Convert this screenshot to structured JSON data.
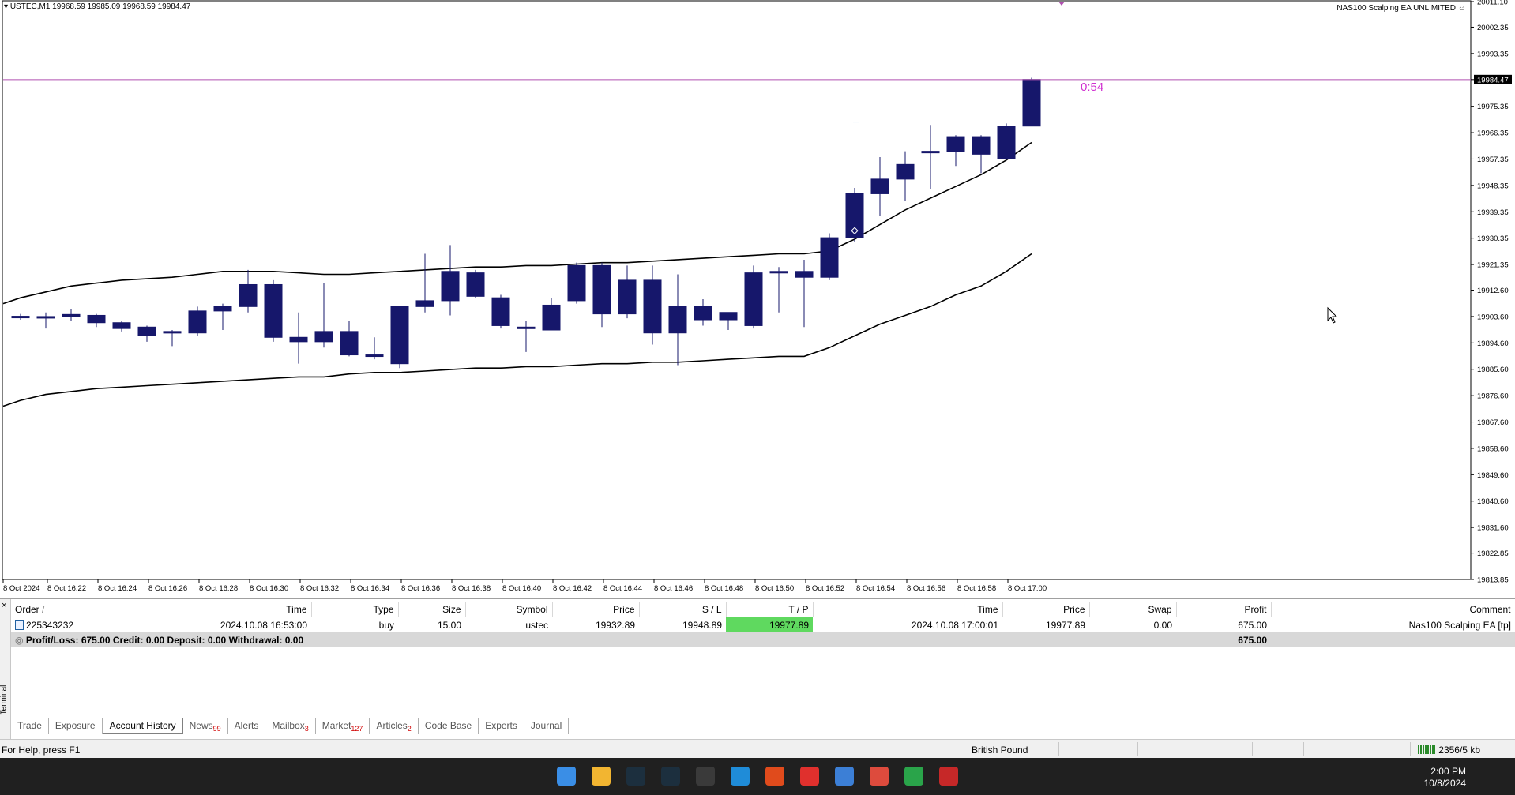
{
  "chart": {
    "info_text": "USTEC,M1  19968.59 19985.09 19968.59 19984.47",
    "ea_label": "NAS100 Scalping EA UNLIMITED",
    "countdown": "0:54",
    "current_price_label": "19984.47",
    "colors": {
      "candle": "#16176b",
      "price_line": "#b050b0",
      "countdown": "#d030d0",
      "band": "#000000"
    }
  },
  "chart_data": {
    "type": "candlestick",
    "symbol": "USTEC",
    "timeframe": "M1",
    "price_axis": {
      "range": [
        19813.85,
        20011.1
      ],
      "ticks": [
        "20011.10",
        "20002.35",
        "19993.35",
        "19984.47",
        "19975.35",
        "19966.35",
        "19957.35",
        "19948.35",
        "19939.35",
        "19930.35",
        "19921.35",
        "19912.60",
        "19903.60",
        "19894.60",
        "19885.60",
        "19876.60",
        "19867.60",
        "19858.60",
        "19849.60",
        "19840.60",
        "19831.60",
        "19822.85",
        "19813.85"
      ]
    },
    "time_axis_labels": [
      "8 Oct 2024",
      "8 Oct 16:22",
      "8 Oct 16:24",
      "8 Oct 16:26",
      "8 Oct 16:28",
      "8 Oct 16:30",
      "8 Oct 16:32",
      "8 Oct 16:34",
      "8 Oct 16:36",
      "8 Oct 16:38",
      "8 Oct 16:40",
      "8 Oct 16:42",
      "8 Oct 16:44",
      "8 Oct 16:46",
      "8 Oct 16:48",
      "8 Oct 16:50",
      "8 Oct 16:52",
      "8 Oct 16:54",
      "8 Oct 16:56",
      "8 Oct 16:58",
      "8 Oct 17:00"
    ],
    "candles": [
      {
        "o": 19903.5,
        "h": 19904.5,
        "l": 19902.5,
        "c": 19903.7
      },
      {
        "o": 19903.6,
        "h": 19905.0,
        "l": 19899.5,
        "c": 19903.6
      },
      {
        "o": 19903.6,
        "h": 19906.0,
        "l": 19902.0,
        "c": 19904.3
      },
      {
        "o": 19904.0,
        "h": 19904.5,
        "l": 19900.0,
        "c": 19901.5
      },
      {
        "o": 19901.5,
        "h": 19902.0,
        "l": 19898.5,
        "c": 19899.5
      },
      {
        "o": 19900.0,
        "h": 19900.5,
        "l": 19895.0,
        "c": 19897.0
      },
      {
        "o": 19898.5,
        "h": 19899.0,
        "l": 19893.5,
        "c": 19898.0
      },
      {
        "o": 19898.0,
        "h": 19907.0,
        "l": 19897.0,
        "c": 19905.5
      },
      {
        "o": 19905.5,
        "h": 19908.0,
        "l": 19899.0,
        "c": 19907.0
      },
      {
        "o": 19907.0,
        "h": 19919.5,
        "l": 19905.0,
        "c": 19914.5
      },
      {
        "o": 19914.5,
        "h": 19916.0,
        "l": 19895.0,
        "c": 19896.5
      },
      {
        "o": 19896.5,
        "h": 19905.0,
        "l": 19887.5,
        "c": 19895.0
      },
      {
        "o": 19895.0,
        "h": 19915.0,
        "l": 19893.0,
        "c": 19898.5
      },
      {
        "o": 19898.5,
        "h": 19902.0,
        "l": 19890.0,
        "c": 19890.5
      },
      {
        "o": 19890.5,
        "h": 19896.5,
        "l": 19889.0,
        "c": 19890.0
      },
      {
        "o": 19887.5,
        "h": 19907.0,
        "l": 19886.0,
        "c": 19907.0
      },
      {
        "o": 19907.0,
        "h": 19925.0,
        "l": 19905.0,
        "c": 19909.0
      },
      {
        "o": 19909.0,
        "h": 19928.0,
        "l": 19904.0,
        "c": 19919.0
      },
      {
        "o": 19918.5,
        "h": 19919.5,
        "l": 19910.0,
        "c": 19910.5
      },
      {
        "o": 19910.0,
        "h": 19911.0,
        "l": 19899.5,
        "c": 19900.5
      },
      {
        "o": 19900.0,
        "h": 19902.0,
        "l": 19891.5,
        "c": 19900.0
      },
      {
        "o": 19907.5,
        "h": 19910.0,
        "l": 19899.0,
        "c": 19899.0
      },
      {
        "o": 19909.0,
        "h": 19922.0,
        "l": 19908.0,
        "c": 19921.0
      },
      {
        "o": 19921.0,
        "h": 19922.0,
        "l": 19900.0,
        "c": 19904.5
      },
      {
        "o": 19904.5,
        "h": 19921.0,
        "l": 19903.0,
        "c": 19916.0
      },
      {
        "o": 19916.0,
        "h": 19921.0,
        "l": 19894.0,
        "c": 19898.0
      },
      {
        "o": 19898.0,
        "h": 19918.0,
        "l": 19887.0,
        "c": 19907.0
      },
      {
        "o": 19907.0,
        "h": 19909.5,
        "l": 19900.5,
        "c": 19902.5
      },
      {
        "o": 19902.5,
        "h": 19905.0,
        "l": 19899.0,
        "c": 19905.0
      },
      {
        "o": 19900.5,
        "h": 19921.0,
        "l": 19899.5,
        "c": 19918.5
      },
      {
        "o": 19918.5,
        "h": 19920.5,
        "l": 19905.0,
        "c": 19919.0
      },
      {
        "o": 19919.0,
        "h": 19923.0,
        "l": 19900.0,
        "c": 19917.0
      },
      {
        "o": 19917.0,
        "h": 19932.0,
        "l": 19916.0,
        "c": 19930.5
      },
      {
        "o": 19930.5,
        "h": 19947.5,
        "l": 19929.0,
        "c": 19945.5
      },
      {
        "o": 19945.5,
        "h": 19958.0,
        "l": 19938.0,
        "c": 19950.5
      },
      {
        "o": 19950.5,
        "h": 19960.0,
        "l": 19943.0,
        "c": 19955.5
      },
      {
        "o": 19959.5,
        "h": 19969.0,
        "l": 19947.0,
        "c": 19960.0
      },
      {
        "o": 19960.0,
        "h": 19965.5,
        "l": 19955.0,
        "c": 19965.0
      },
      {
        "o": 19965.0,
        "h": 19965.5,
        "l": 19952.5,
        "c": 19959.0
      },
      {
        "o": 19957.5,
        "h": 19969.5,
        "l": 19957.0,
        "c": 19968.5
      },
      {
        "o": 19968.6,
        "h": 19985.1,
        "l": 19968.6,
        "c": 19984.5
      }
    ],
    "upper_band": [
      19910,
      19912,
      19914,
      19915,
      19916,
      19916.5,
      19917,
      19918,
      19919,
      19919,
      19919,
      19918.5,
      19918,
      19918,
      19918.5,
      19919,
      19919.5,
      19920,
      19920.5,
      19920.5,
      19921,
      19921,
      19921.5,
      19922,
      19922,
      19922.5,
      19923,
      19923.5,
      19924,
      19924.5,
      19925,
      19925,
      19926,
      19930,
      19935,
      19940,
      19944,
      19948,
      19952,
      19957,
      19963
    ],
    "lower_band": [
      19875,
      19877,
      19878,
      19879,
      19879.5,
      19880,
      19880.5,
      19881,
      19881.5,
      19882,
      19882.5,
      19883,
      19883,
      19884,
      19884.5,
      19884.5,
      19885,
      19885.5,
      19886,
      19886,
      19886.5,
      19886.5,
      19887,
      19887.5,
      19887.5,
      19888,
      19888,
      19888.5,
      19889,
      19889.5,
      19890,
      19890,
      19893,
      19897,
      19901,
      19904,
      19907,
      19911,
      19914,
      19919,
      19925
    ]
  },
  "terminal": {
    "close_label": "×",
    "vertical_label": "Terminal",
    "columns": [
      "Order",
      "/",
      "Time",
      "Type",
      "Size",
      "Symbol",
      "Price",
      "S / L",
      "T / P",
      "Time",
      "Price",
      "Swap",
      "Profit",
      "Comment"
    ],
    "rows": [
      {
        "order": "225343232",
        "open_time": "2024.10.08 16:53:00",
        "type": "buy",
        "size": "15.00",
        "symbol": "ustec",
        "open_price": "19932.89",
        "sl": "19948.89",
        "tp": "19977.89",
        "close_time": "2024.10.08 17:00:01",
        "close_price": "19977.89",
        "swap": "0.00",
        "profit": "675.00",
        "comment": "Nas100 Scalping EA [tp]"
      }
    ],
    "summary": {
      "text": "Profit/Loss: 675.00  Credit: 0.00  Deposit: 0.00  Withdrawal: 0.00",
      "profit": "675.00"
    },
    "tabs": [
      {
        "label": "Trade"
      },
      {
        "label": "Exposure"
      },
      {
        "label": "Account History",
        "active": true
      },
      {
        "label": "News",
        "badge": "99"
      },
      {
        "label": "Alerts"
      },
      {
        "label": "Mailbox",
        "badge": "3"
      },
      {
        "label": "Market",
        "badge": "127"
      },
      {
        "label": "Articles",
        "badge": "2"
      },
      {
        "label": "Code Base"
      },
      {
        "label": "Experts"
      },
      {
        "label": "Journal"
      }
    ]
  },
  "statusbar": {
    "help": "For Help, press F1",
    "currency": "British Pound",
    "traffic": "2356/5 kb"
  },
  "taskbar": {
    "time": "2:00 PM",
    "date": "10/8/2024",
    "icons": [
      {
        "name": "windows-start-icon",
        "color": "#3a8ee6"
      },
      {
        "name": "file-explorer-icon",
        "color": "#f2b531"
      },
      {
        "name": "metatrader-icon-1",
        "color": "#1c2f3e"
      },
      {
        "name": "metatrader-icon-2",
        "color": "#1c2f3e"
      },
      {
        "name": "app-icon",
        "color": "#3a3a3a"
      },
      {
        "name": "edge-icon",
        "color": "#1f8cd8"
      },
      {
        "name": "ninjatrader-icon",
        "color": "#e04b1c"
      },
      {
        "name": "app-red-icon",
        "color": "#e0302d"
      },
      {
        "name": "app-blue-icon",
        "color": "#3c7fd6"
      },
      {
        "name": "chrome-icon",
        "color": "#dd4b3d"
      },
      {
        "name": "tradingview-icon",
        "color": "#2aa44a"
      },
      {
        "name": "recorder-icon",
        "color": "#c62828"
      }
    ]
  }
}
